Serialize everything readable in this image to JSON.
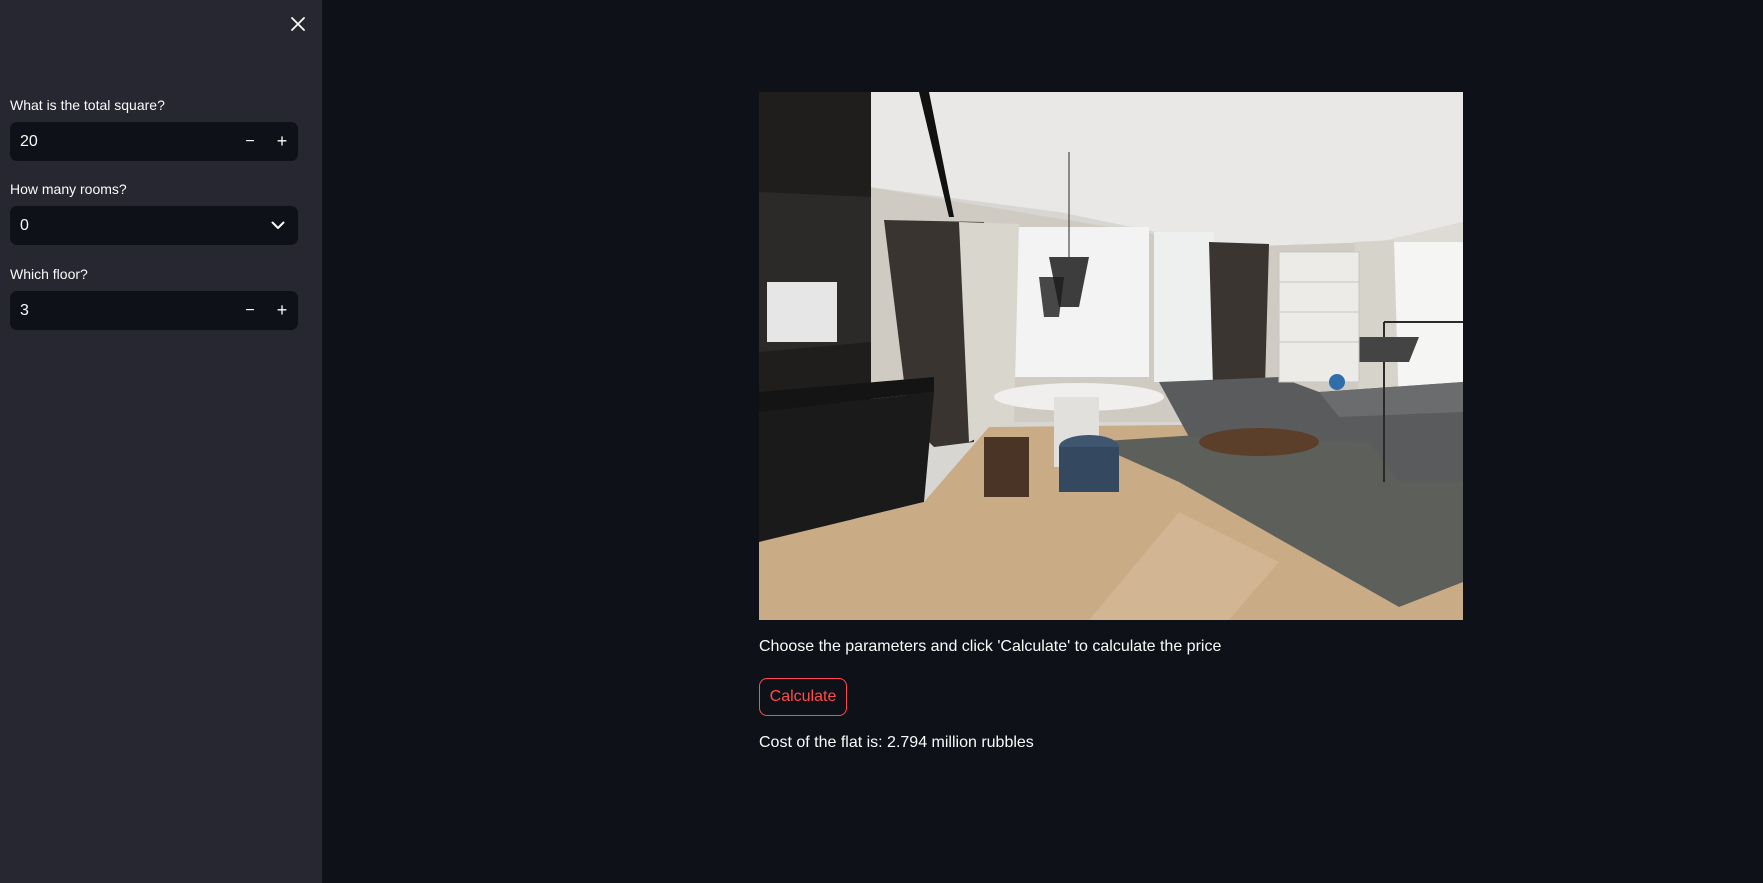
{
  "sidebar": {
    "fields": [
      {
        "label": "What is the total square?",
        "value": "20",
        "type": "number"
      },
      {
        "label": "How many rooms?",
        "value": "0",
        "type": "select"
      },
      {
        "label": "Which floor?",
        "value": "3",
        "type": "number"
      }
    ],
    "close_icon": "close-icon",
    "minus_symbol": "−",
    "plus_symbol": "+"
  },
  "main": {
    "instructions": "Choose the parameters and click 'Calculate' to calculate the price",
    "calculate_label": "Calculate",
    "result": "Cost of the flat is: 2.794 million rubbles"
  },
  "colors": {
    "background": "#0e1117",
    "sidebar": "#262730",
    "accent": "#ff4b4b",
    "text": "#fafafa"
  }
}
